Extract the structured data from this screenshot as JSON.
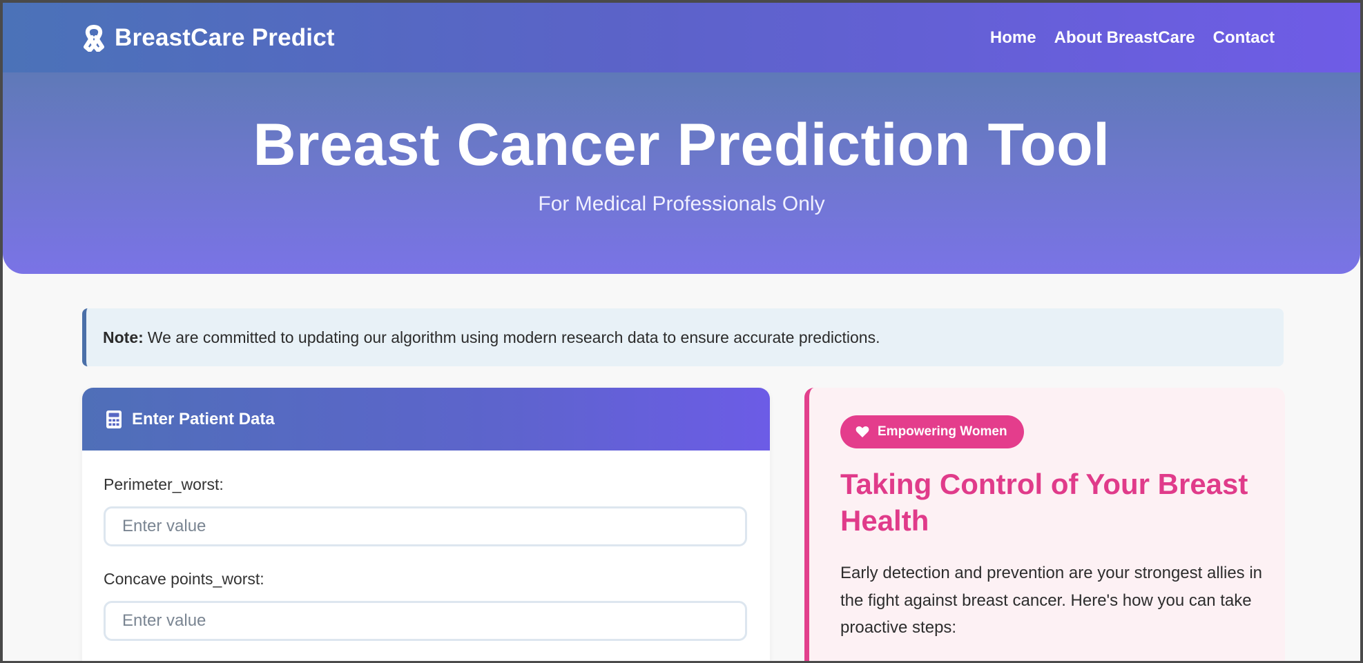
{
  "navbar": {
    "brand": "BreastCare Predict",
    "links": [
      "Home",
      "About BreastCare",
      "Contact"
    ]
  },
  "hero": {
    "title": "Breast Cancer Prediction Tool",
    "subtitle": "For Medical Professionals Only"
  },
  "note": {
    "label": "Note:",
    "text": "We are committed to updating our algorithm using modern research data to ensure accurate predictions."
  },
  "form": {
    "title": "Enter Patient Data",
    "fields": [
      {
        "label": "Perimeter_worst:",
        "placeholder": "Enter value"
      },
      {
        "label": "Concave points_worst:",
        "placeholder": "Enter value"
      }
    ]
  },
  "info": {
    "badge": "Empowering Women",
    "title": "Taking Control of Your Breast Health",
    "text": "Early detection and prevention are your strongest allies in the fight against breast cancer. Here's how you can take proactive steps:"
  },
  "colors": {
    "accent_pink": "#e43d8c",
    "nav_gradient_start": "#4b72b8",
    "nav_gradient_end": "#6f5ce6"
  }
}
